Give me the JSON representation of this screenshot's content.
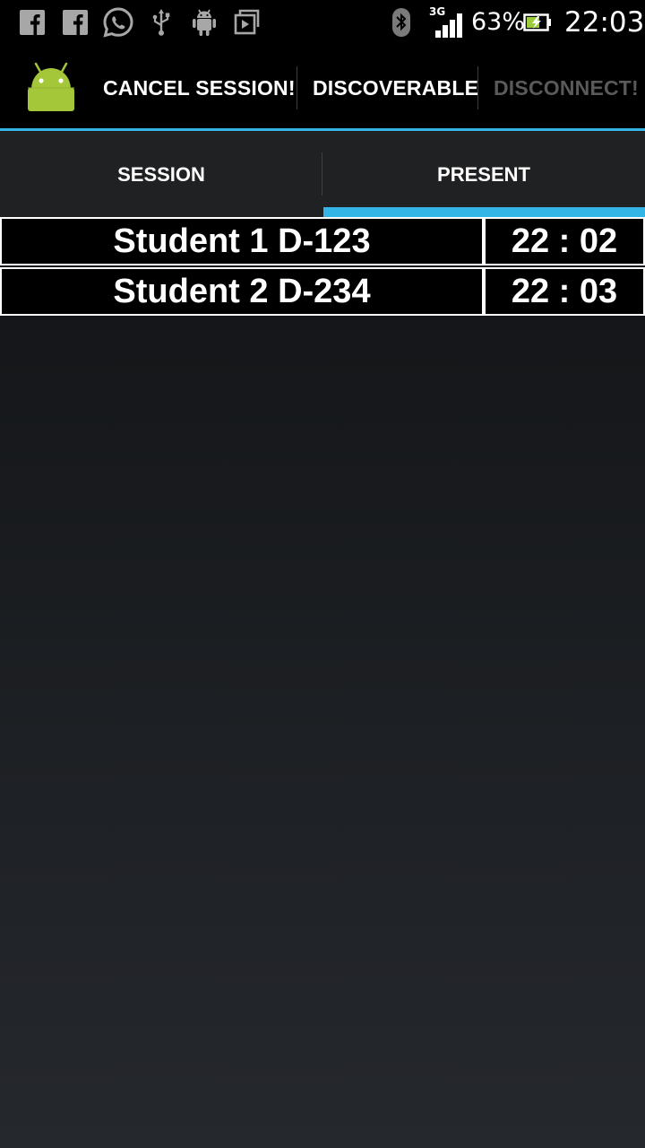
{
  "status_bar": {
    "icons_left": [
      "facebook-icon",
      "facebook-icon",
      "whatsapp-icon",
      "usb-icon",
      "android-debug-icon",
      "media-icon"
    ],
    "icons_right": [
      "bluetooth-icon",
      "signal-icon",
      "battery-charging-icon"
    ],
    "network_type": "3G",
    "battery": "63%",
    "time": "22:03"
  },
  "action_bar": {
    "app_icon": "android-icon",
    "actions": [
      {
        "label": "CANCEL SESSION!",
        "enabled": true
      },
      {
        "label": "DISCOVERABLE",
        "enabled": true
      },
      {
        "label": "DISCONNECT!",
        "enabled": false
      }
    ]
  },
  "tabs": [
    {
      "label": "SESSION",
      "selected": false
    },
    {
      "label": "PRESENT",
      "selected": true
    }
  ],
  "attendance": {
    "rows": [
      {
        "name": "Student 1 D-123",
        "time": "22 : 02"
      },
      {
        "name": "Student 2 D-234",
        "time": "22 : 03"
      }
    ]
  },
  "colors": {
    "accent": "#33b5e5",
    "android_green": "#a4c639",
    "battery_fill": "#9ccc3c"
  }
}
